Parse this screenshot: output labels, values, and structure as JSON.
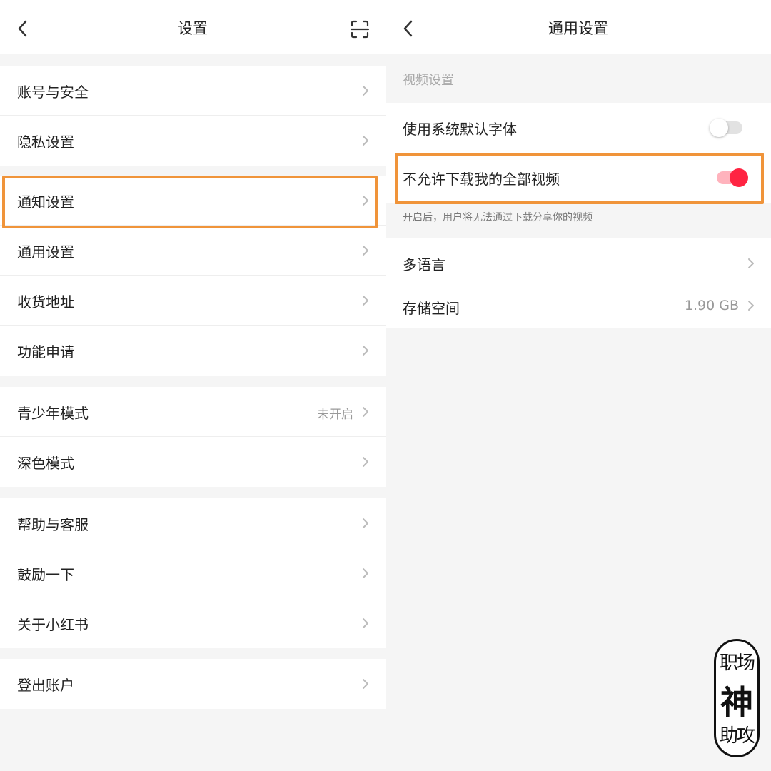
{
  "left": {
    "title": "设置",
    "items": [
      {
        "label": "账号与安全"
      },
      {
        "label": "隐私设置"
      },
      {
        "label": "通知设置"
      },
      {
        "label": "通用设置"
      },
      {
        "label": "收货地址"
      },
      {
        "label": "功能申请"
      },
      {
        "label": "青少年模式",
        "value": "未开启"
      },
      {
        "label": "深色模式"
      },
      {
        "label": "帮助与客服"
      },
      {
        "label": "鼓励一下"
      },
      {
        "label": "关于小红书"
      },
      {
        "label": "登出账户"
      }
    ]
  },
  "right": {
    "title": "通用设置",
    "section_header": "视频设置",
    "system_font": {
      "label": "使用系统默认字体",
      "enabled": false
    },
    "disallow_download": {
      "label": "不允许下载我的全部视频",
      "enabled": true
    },
    "hint": "开启后，用户将无法通过下载分享你的视频",
    "language": {
      "label": "多语言"
    },
    "storage": {
      "label": "存储空间",
      "value": "1.90 GB"
    }
  },
  "watermark": {
    "line1": "职场",
    "line2": "神",
    "line3": "助攻"
  },
  "colors": {
    "highlight": "#f0943a",
    "accent": "#ff2442",
    "accent_track": "#ffb3bd"
  }
}
